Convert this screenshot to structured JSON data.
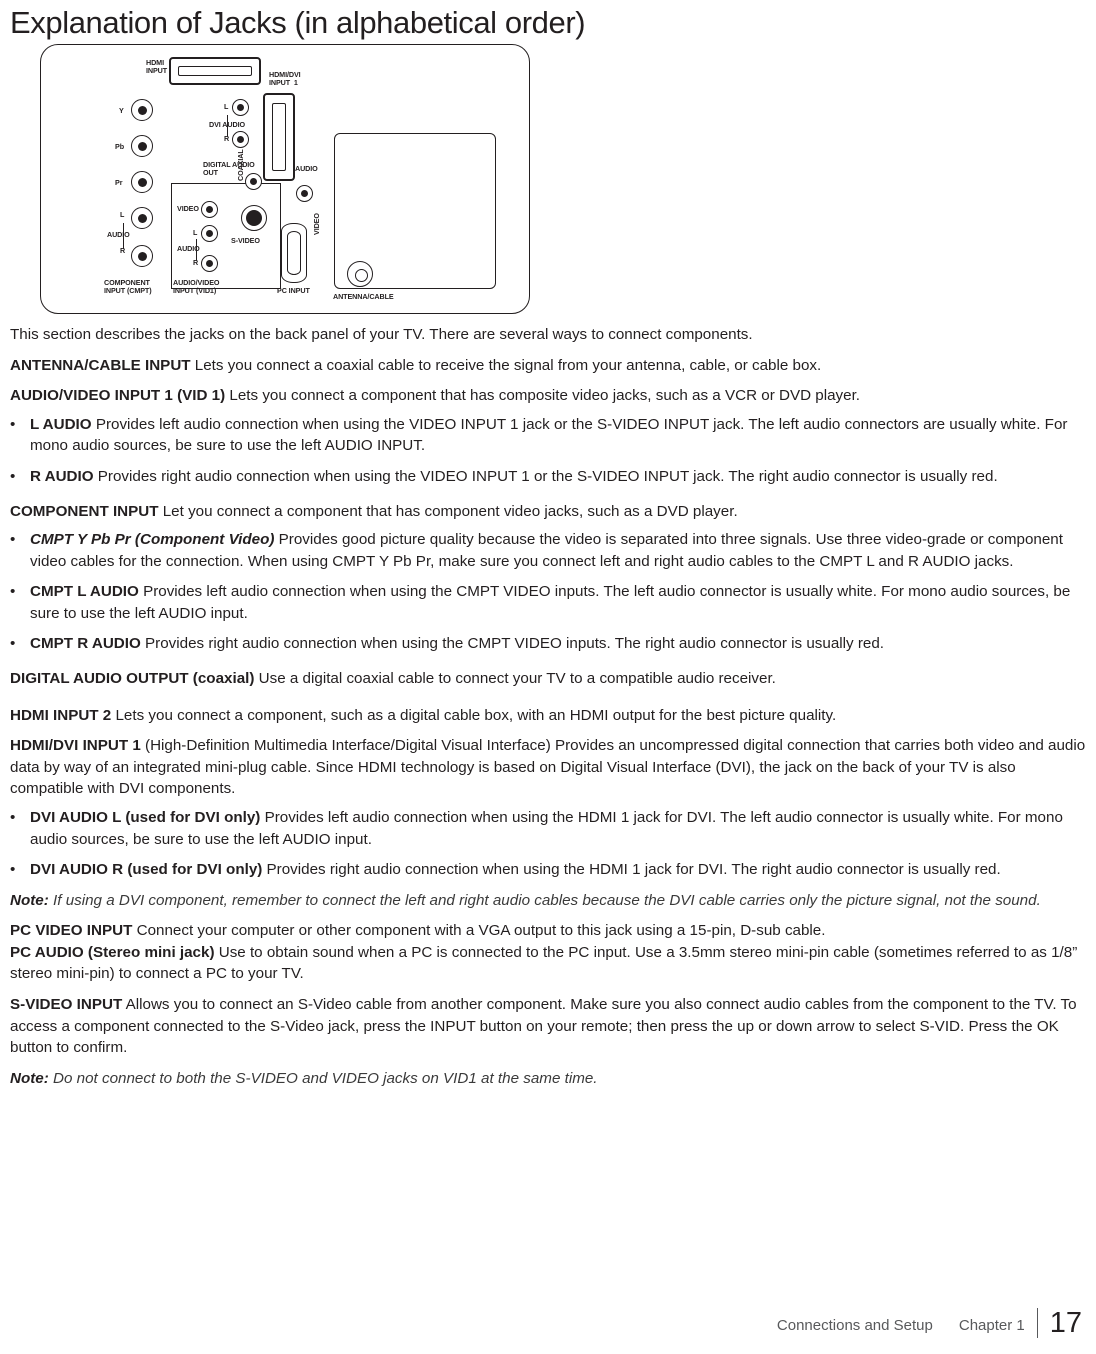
{
  "page": {
    "title": "Explanation of Jacks (in alphabetical order)",
    "number": "17"
  },
  "diagram": {
    "name": "tv-back-panel-jacks",
    "labels": {
      "hdmi_input_2": "HDMI\nINPUT 2",
      "hdmi_dvi_input_1": "HDMI/DVI\nINPUT  1",
      "dvi_audio": "DVI AUDIO",
      "dvi_audio_l": "L",
      "dvi_audio_r": "R",
      "digital_audio_out": "DIGITAL AUDIO\nOUT",
      "coaxial": "COAXIAL",
      "audio": "AUDIO",
      "video": "VIDEO",
      "video_vga": "VIDEO",
      "s_video": "S-VIDEO",
      "y": "Y",
      "pb": "Pb",
      "pr": "Pr",
      "audio_left_cmpt": "L",
      "audio_label_cmpt": "AUDIO",
      "audio_right_cmpt": "R",
      "audio_left_vid": "L",
      "audio_label_vid": "AUDIO",
      "audio_right_vid": "R",
      "component_input": "COMPONENT\nINPUT (CMPT)",
      "audio_video_input": "AUDIO/VIDEO\nINPUT (VID1)",
      "pc_input": "PC INPUT",
      "antenna_cable": "ANTENNA/CABLE"
    }
  },
  "content": {
    "intro": "This section describes the jacks on the back panel of your TV. There are several ways to connect components.",
    "antenna": {
      "term": "ANTENNA/CABLE INPUT",
      "text": "  Lets you connect a coaxial cable to receive the signal from your antenna, cable, or cable box."
    },
    "av_input": {
      "term": "AUDIO/VIDEO INPUT 1 (VID 1)",
      "text": " Lets you connect a component that has composite video jacks, such as a VCR or DVD player."
    },
    "l_audio": {
      "term": "L AUDIO",
      "text": " Provides left audio connection when using the VIDEO INPUT 1 jack or the S-VIDEO INPUT jack. The left audio connectors are usually white. For mono audio sources, be sure to use the left AUDIO INPUT."
    },
    "r_audio": {
      "term": "R AUDIO",
      "text": " Provides right audio connection when using the VIDEO INPUT 1 or the S-VIDEO INPUT jack. The right audio connector is usually red."
    },
    "component": {
      "term": "COMPONENT INPUT",
      "text": " Let you connect a component that has component video jacks, such as a DVD player."
    },
    "cmpt_ypbpr": {
      "term": "CMPT Y Pb Pr (Component Video)",
      "text": " Provides good picture quality because the video is separated into three signals. Use three video-grade or component video cables for the connection. When using CMPT Y Pb Pr, make sure you connect left and right audio cables to the CMPT L and R AUDIO jacks."
    },
    "cmpt_l": {
      "term": "CMPT L AUDIO",
      "text": " Provides left audio connection when using the  CMPT VIDEO inputs. The left audio connector is usually white. For mono audio sources, be sure to use the left AUDIO input."
    },
    "cmpt_r": {
      "term": "CMPT R AUDIO",
      "text": " Provides right audio connection when using the CMPT VIDEO inputs. The right audio connector is usually red."
    },
    "digital_audio": {
      "term": "DIGITAL AUDIO OUTPUT (coaxial)",
      "text": " Use a digital coaxial cable to connect your TV to a compatible audio receiver."
    },
    "hdmi2": {
      "term": "HDMI INPUT 2",
      "text": "  Lets you connect a component, such as a digital cable box, with an HDMI output for the best picture quality."
    },
    "hdmi_dvi": {
      "term": "HDMI/DVI INPUT 1",
      "text": " (High-Definition Multimedia Interface/Digital Visual Interface) Provides an uncompressed digital connection that carries both video and audio data by way of an integrated mini-plug cable. Since HDMI technology is based on Digital Visual Interface (DVI), the jack on the back of your TV is also compatible with DVI components."
    },
    "dvi_audio_l": {
      "term": "DVI AUDIO L (used for DVI only)",
      "text": " Provides left audio connection when using the HDMI 1 jack for DVI. The left audio connector is usually white. For mono audio sources, be sure to use the left AUDIO input."
    },
    "dvi_audio_r": {
      "term": "DVI AUDIO R (used for DVI only)",
      "text": " Provides right audio connection when using the HDMI 1 jack for DVI. The right audio connector is usually red."
    },
    "note1": {
      "label": "Note:",
      "text": " If using a DVI component, remember to connect the left and right audio cables because the DVI cable carries only the picture signal, not the sound."
    },
    "pc_video": {
      "term": "PC VIDEO INPUT",
      "text": "  Connect your computer or other component with a VGA output to this jack using a 15-pin, D-sub cable."
    },
    "pc_audio": {
      "term": "PC AUDIO (Stereo mini jack)",
      "text": " Use to obtain sound when a PC is connected to the PC input. Use a 3.5mm stereo mini-pin cable (sometimes referred to as 1/8” stereo mini-pin) to connect a PC to your TV."
    },
    "s_video": {
      "term": "S-VIDEO INPUT",
      "text": "  Allows you to connect an S-Video cable from another component. Make sure you also connect audio cables from the component to the TV. To access a component connected to the S-Video jack, press the INPUT button on your remote; then press the up or down arrow to select S-VID. Press the OK button to confirm."
    },
    "note2": {
      "label": "Note:",
      "text": " Do not connect to both the S-VIDEO and VIDEO jacks on VID1 at the same time."
    }
  },
  "footer": {
    "section": "Connections and Setup",
    "chapter": "Chapter 1"
  }
}
